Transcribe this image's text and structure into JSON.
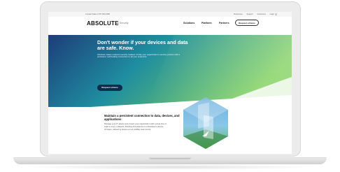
{
  "topbar": {
    "contact": "Contact Sales 1 877 660 2289",
    "links": [
      "Resources",
      "Support",
      "Customers",
      "Login"
    ]
  },
  "nav": {
    "logo": "ABSOLUTE",
    "logo_sub": "| Security",
    "items": [
      "Solutions",
      "Platform",
      "Partners"
    ],
    "cta": "Request a Demo"
  },
  "hero": {
    "title": "Don't wonder if your devices and data are safe. Know.",
    "body": "Absolute makes endpoint security resilient. Fortify your organization's security posture with a persistent, self-healing connection to all your endpoints.",
    "cta": "Request a Demo"
  },
  "feature": {
    "title": "Maintain a persistent connection to data, devices, and applications",
    "body": "Manage your IT assets and protect your organization with a clear line of sight to every endpoint. Absolute Persistence is embedded in device firmware, delivering tamper-proof visibility and control."
  },
  "colors": {
    "hero_start": "#1d3d7a",
    "hero_mid": "#1f8ea0",
    "hero_end": "#7ed05a",
    "button_dark": "#0e2c4a"
  }
}
